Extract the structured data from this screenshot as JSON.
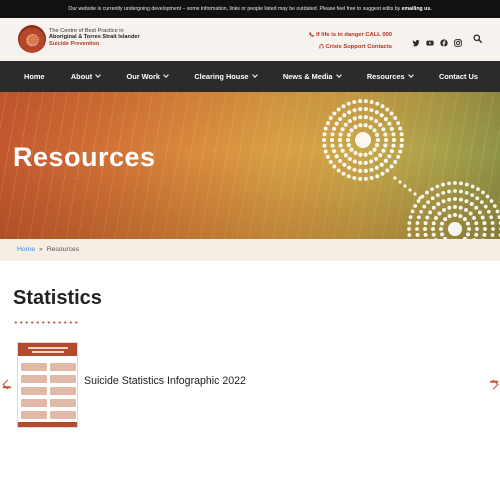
{
  "notice": {
    "text": "Our website is currently undergoing development – some information, links or people listed may be outdated. Please feel free to suggest edits by ",
    "link": "emailing us."
  },
  "header": {
    "logo": {
      "line1": "The Centre of Best Practice in",
      "line2": "Aboriginal & Torres Strait Islander",
      "line3": "Suicide Prevention"
    },
    "danger": "If life is in danger CALL 000",
    "crisis": "Crisis Support Contacts",
    "social_icons": [
      "twitter-icon",
      "youtube-icon",
      "facebook-icon",
      "instagram-icon"
    ],
    "search_icon": "search-icon"
  },
  "nav": {
    "items": [
      {
        "label": "Home",
        "dropdown": false
      },
      {
        "label": "About",
        "dropdown": true
      },
      {
        "label": "Our Work",
        "dropdown": true
      },
      {
        "label": "Clearing House",
        "dropdown": true
      },
      {
        "label": "News & Media",
        "dropdown": true
      },
      {
        "label": "Resources",
        "dropdown": true
      },
      {
        "label": "Contact Us",
        "dropdown": false
      }
    ]
  },
  "hero": {
    "title": "Resources"
  },
  "breadcrumb": {
    "home": "Home",
    "separator": "»",
    "current": "Resources"
  },
  "main": {
    "section_title": "Statistics",
    "carousel": {
      "items": [
        {
          "title": "Suicide Statistics Infographic 2022"
        }
      ],
      "prev_icon": "arrow-left-icon",
      "next_icon": "arrow-right-icon"
    }
  },
  "colors": {
    "accent": "#b8321e",
    "nav_bg": "#2b2b2b",
    "link": "#3d8fd6",
    "breadcrumb_bg": "#f4eee5"
  }
}
